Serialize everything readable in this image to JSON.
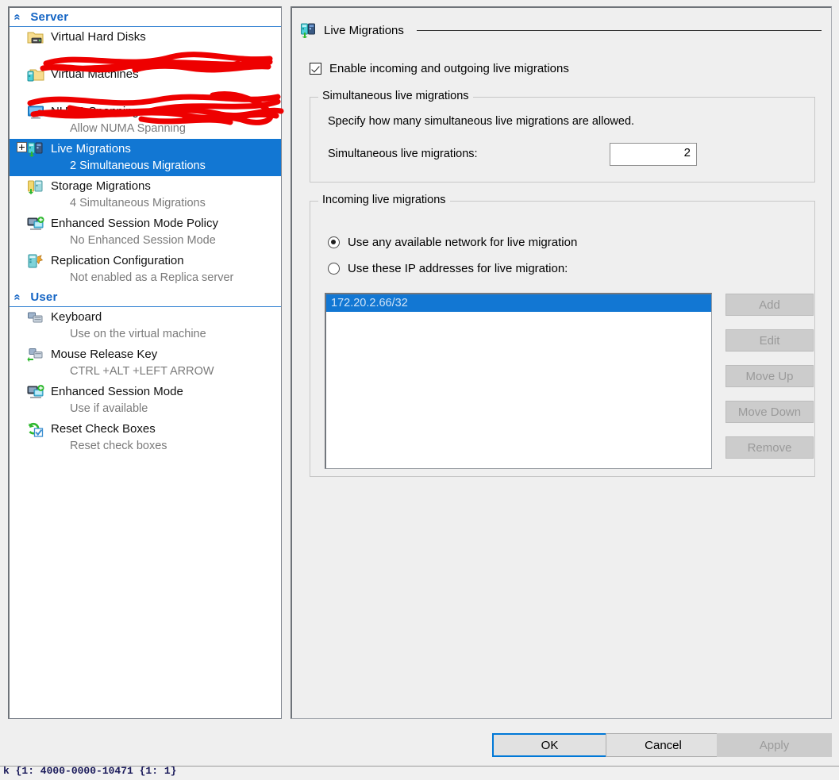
{
  "sidebar": {
    "sections": [
      {
        "name": "server-section",
        "title": "Server",
        "chevron": "collapse-chevron-icon",
        "items": [
          {
            "label": "Virtual Hard Disks",
            "sub": "",
            "icon": "virtual-hard-disk-icon",
            "selected": false,
            "expandable": false,
            "redacted": true
          },
          {
            "label": "Virtual Machines",
            "sub": "",
            "icon": "virtual-machines-icon",
            "selected": false,
            "expandable": false,
            "redacted": true
          },
          {
            "label": "NUMA Spanning",
            "sub": "Allow NUMA Spanning",
            "icon": "numa-spanning-icon",
            "selected": false,
            "expandable": false,
            "redacted": false
          },
          {
            "label": "Live Migrations",
            "sub": "2 Simultaneous Migrations",
            "icon": "live-migrations-icon",
            "selected": true,
            "expandable": true,
            "redacted": false
          },
          {
            "label": "Storage Migrations",
            "sub": "4 Simultaneous Migrations",
            "icon": "storage-migrations-icon",
            "selected": false,
            "expandable": false,
            "redacted": false
          },
          {
            "label": "Enhanced Session Mode Policy",
            "sub": "No Enhanced Session Mode",
            "icon": "enhanced-session-mode-policy-icon",
            "selected": false,
            "expandable": false,
            "redacted": false
          },
          {
            "label": "Replication Configuration",
            "sub": "Not enabled as a Replica server",
            "icon": "replication-configuration-icon",
            "selected": false,
            "expandable": false,
            "redacted": false
          }
        ]
      },
      {
        "name": "user-section",
        "title": "User",
        "chevron": "collapse-chevron-icon",
        "items": [
          {
            "label": "Keyboard",
            "sub": "Use on the virtual machine",
            "icon": "keyboard-icon",
            "selected": false,
            "expandable": false,
            "redacted": false
          },
          {
            "label": "Mouse Release Key",
            "sub": "CTRL +ALT +LEFT ARROW",
            "icon": "mouse-release-key-icon",
            "selected": false,
            "expandable": false,
            "redacted": false
          },
          {
            "label": "Enhanced Session Mode",
            "sub": "Use if available",
            "icon": "enhanced-session-mode-icon",
            "selected": false,
            "expandable": false,
            "redacted": false
          },
          {
            "label": "Reset Check Boxes",
            "sub": "Reset check boxes",
            "icon": "reset-check-boxes-icon",
            "selected": false,
            "expandable": false,
            "redacted": false
          }
        ]
      }
    ]
  },
  "pane": {
    "title": "Live Migrations",
    "title_icon": "live-migrations-icon",
    "enable_checkbox": {
      "label": "Enable incoming and outgoing live migrations",
      "checked": true
    },
    "simultaneous_group": {
      "legend": "Simultaneous live migrations",
      "description": "Specify how many simultaneous live migrations are allowed.",
      "field_label": "Simultaneous live migrations:",
      "value": "2"
    },
    "incoming_group": {
      "legend": "Incoming live migrations",
      "radio_any": {
        "label": "Use any available network for live migration",
        "selected": true
      },
      "radio_specific": {
        "label": "Use these IP addresses for live migration:",
        "selected": false
      },
      "ip_addresses": [
        {
          "value": "172.20.2.66/32",
          "selected": true
        }
      ],
      "buttons": [
        {
          "label": "Add",
          "enabled": false
        },
        {
          "label": "Edit",
          "enabled": false
        },
        {
          "label": "Move Up",
          "enabled": false
        },
        {
          "label": "Move Down",
          "enabled": false
        },
        {
          "label": "Remove",
          "enabled": false
        }
      ]
    }
  },
  "footer": {
    "ok": "OK",
    "cancel": "Cancel",
    "apply": "Apply",
    "apply_enabled": false,
    "ok_focused": true
  },
  "status_strip": {
    "clipped_text": "k {1: 4000-0000-10471   {1: 1}"
  },
  "colors": {
    "accent": "#1277d3",
    "section_header_text": "#1364c4",
    "selection_bg": "#1277d3",
    "redaction": "#ee0000",
    "disabled_text": "#9a9a9a",
    "sub_text": "#7a7a7a",
    "dialog_bg": "#efefef"
  }
}
